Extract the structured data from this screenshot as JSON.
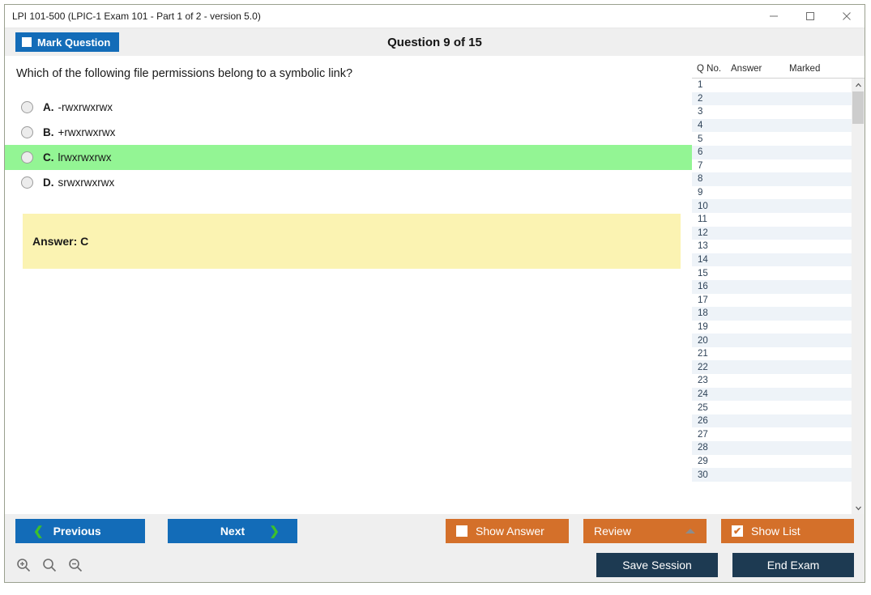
{
  "window": {
    "title": "LPI 101-500 (LPIC-1 Exam 101 - Part 1 of 2 - version 5.0)",
    "minimize_label": "minimize",
    "maximize_label": "maximize",
    "close_label": "close"
  },
  "toolbar": {
    "mark_question_label": "Mark Question",
    "mark_question_checked": false,
    "question_counter": "Question 9 of 15"
  },
  "question": {
    "text": "Which of the following file permissions belong to a symbolic link?",
    "options": [
      {
        "letter": "A.",
        "text": "-rwxrwxrwx",
        "correct": false
      },
      {
        "letter": "B.",
        "text": "+rwxrwxrwx",
        "correct": false
      },
      {
        "letter": "C.",
        "text": "lrwxrwxrwx",
        "correct": true
      },
      {
        "letter": "D.",
        "text": "srwxrwxrwx",
        "correct": false
      }
    ],
    "answer_label": "Answer: C"
  },
  "question_list": {
    "columns": [
      "Q No.",
      "Answer",
      "Marked"
    ],
    "rows": [
      {
        "no": "1",
        "answer": "",
        "marked": ""
      },
      {
        "no": "2",
        "answer": "",
        "marked": ""
      },
      {
        "no": "3",
        "answer": "",
        "marked": ""
      },
      {
        "no": "4",
        "answer": "",
        "marked": ""
      },
      {
        "no": "5",
        "answer": "",
        "marked": ""
      },
      {
        "no": "6",
        "answer": "",
        "marked": ""
      },
      {
        "no": "7",
        "answer": "",
        "marked": ""
      },
      {
        "no": "8",
        "answer": "",
        "marked": ""
      },
      {
        "no": "9",
        "answer": "",
        "marked": ""
      },
      {
        "no": "10",
        "answer": "",
        "marked": ""
      },
      {
        "no": "11",
        "answer": "",
        "marked": ""
      },
      {
        "no": "12",
        "answer": "",
        "marked": ""
      },
      {
        "no": "13",
        "answer": "",
        "marked": ""
      },
      {
        "no": "14",
        "answer": "",
        "marked": ""
      },
      {
        "no": "15",
        "answer": "",
        "marked": ""
      },
      {
        "no": "16",
        "answer": "",
        "marked": ""
      },
      {
        "no": "17",
        "answer": "",
        "marked": ""
      },
      {
        "no": "18",
        "answer": "",
        "marked": ""
      },
      {
        "no": "19",
        "answer": "",
        "marked": ""
      },
      {
        "no": "20",
        "answer": "",
        "marked": ""
      },
      {
        "no": "21",
        "answer": "",
        "marked": ""
      },
      {
        "no": "22",
        "answer": "",
        "marked": ""
      },
      {
        "no": "23",
        "answer": "",
        "marked": ""
      },
      {
        "no": "24",
        "answer": "",
        "marked": ""
      },
      {
        "no": "25",
        "answer": "",
        "marked": ""
      },
      {
        "no": "26",
        "answer": "",
        "marked": ""
      },
      {
        "no": "27",
        "answer": "",
        "marked": ""
      },
      {
        "no": "28",
        "answer": "",
        "marked": ""
      },
      {
        "no": "29",
        "answer": "",
        "marked": ""
      },
      {
        "no": "30",
        "answer": "",
        "marked": ""
      }
    ],
    "scroll_up_label": "scroll up",
    "scroll_down_label": "scroll down"
  },
  "footer": {
    "previous_label": "Previous",
    "next_label": "Next",
    "prev_chevron": "❮",
    "next_chevron": "❯",
    "show_answer_label": "Show Answer",
    "show_answer_checked": false,
    "review_label": "Review",
    "show_list_label": "Show List",
    "show_list_checked": true,
    "show_list_check_glyph": "✔",
    "save_session_label": "Save Session",
    "end_exam_label": "End Exam",
    "zoom_in_label": "zoom in",
    "zoom_reset_label": "zoom reset",
    "zoom_out_label": "zoom out"
  },
  "colors": {
    "primary_blue": "#136cb8",
    "accent_orange": "#d4702a",
    "dark_navy": "#1d3a52",
    "correct_green": "#93f594",
    "answer_yellow": "#fbf3b2",
    "chevron_green": "#3cbf2e"
  }
}
